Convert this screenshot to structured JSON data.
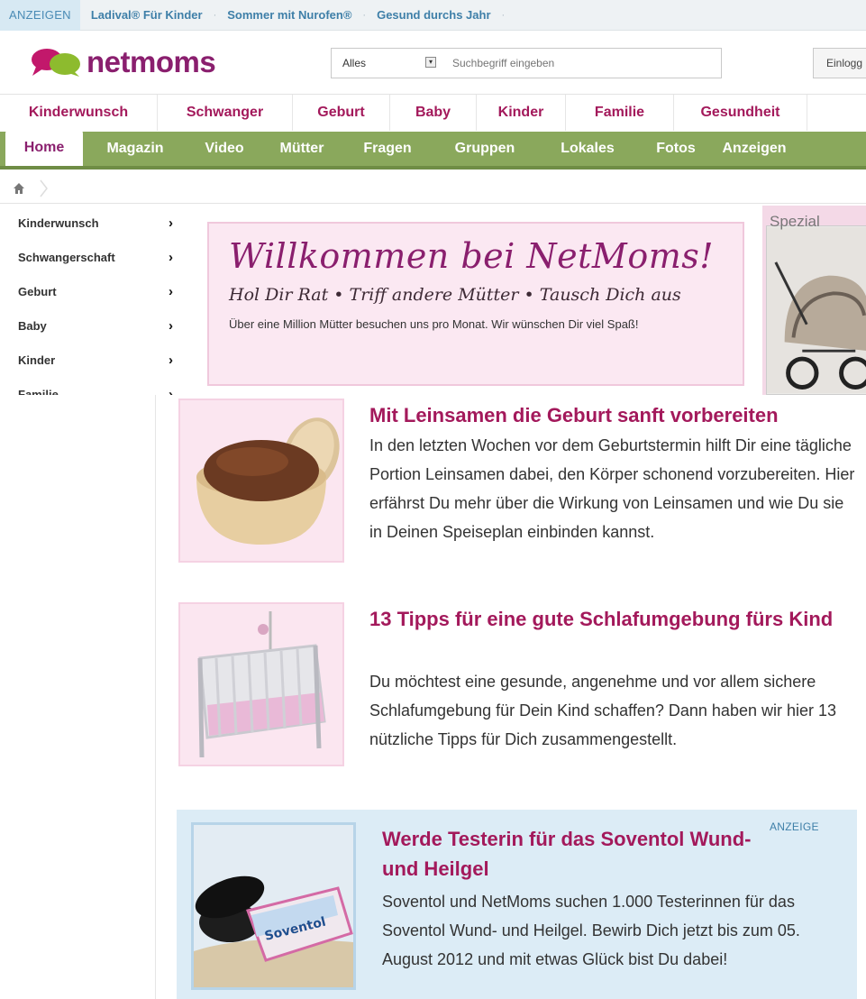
{
  "adbar": {
    "tag": "ANZEIGEN",
    "links": [
      "Ladival® Für Kinder",
      "Sommer mit Nurofen®",
      "Gesund durchs Jahr"
    ]
  },
  "header": {
    "logo_text": "netmoms",
    "search": {
      "scope": "Alles",
      "placeholder": "Suchbegriff eingeben"
    },
    "login_label": "Einlogg"
  },
  "catnav": [
    "Kinderwunsch",
    "Schwanger",
    "Geburt",
    "Baby",
    "Kinder",
    "Familie",
    "Gesundheit"
  ],
  "greennav": [
    "Home",
    "Magazin",
    "Video",
    "Mütter",
    "Fragen",
    "Gruppen",
    "Lokales",
    "Fotos",
    "Anzeigen"
  ],
  "sidebar": [
    "Kinderwunsch",
    "Schwangerschaft",
    "Geburt",
    "Baby",
    "Kinder",
    "Familie"
  ],
  "welcome": {
    "title": "Willkommen bei NetMoms!",
    "subtitle": "Hol Dir Rat • Triff andere Mütter • Tausch Dich aus",
    "text": "Über eine Million Mütter besuchen uns pro Monat. Wir wünschen Dir viel Spaß!"
  },
  "spezial": {
    "label": "Spezial"
  },
  "articles": [
    {
      "title": "Mit Leinsamen die Geburt sanft vorbereiten",
      "text": "In den letzten Wochen vor dem Geburtstermin hilft Dir eine tägliche Portion Leinsamen dabei, den Körper schonend vorzubereiten. Hier erfährst Du mehr über die Wirkung von Leinsamen und wie Du sie in Deinen Speiseplan einbinden kannst."
    },
    {
      "title": "13 Tipps für eine gute Schlafumgebung fürs Kind",
      "text": "Du möchtest eine gesunde, angenehme und vor allem sichere Schlafumgebung für Dein Kind schaffen? Dann haben wir hier 13 nützliche Tipps für Dich zusammengestellt."
    }
  ],
  "ad": {
    "badge": "ANZEIGE",
    "title": "Werde Testerin für das Soventol Wund- und Heilgel",
    "text": "Soventol und NetMoms suchen 1.000 Testerinnen für das Soventol Wund- und Heilgel. Bewirb Dich jetzt bis zum 05. August 2012 und mit etwas Glück bist Du dabei!",
    "product_label": "Soventol"
  }
}
